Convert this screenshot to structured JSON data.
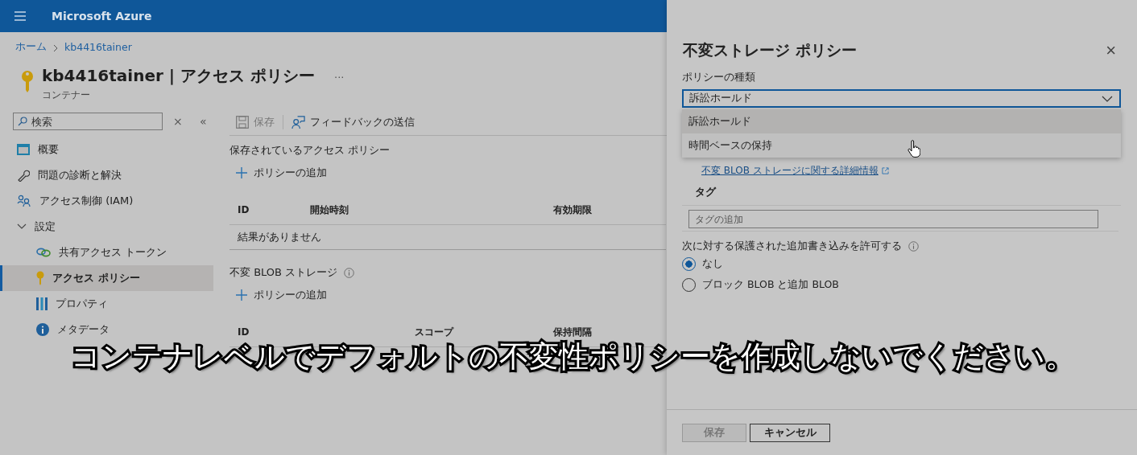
{
  "topbar": {
    "title": "Microsoft Azure"
  },
  "breadcrumb": [
    {
      "label": "ホーム"
    },
    {
      "label": "kb4416tainer"
    }
  ],
  "header": {
    "title": "kb4416tainer | アクセス ポリシー",
    "more": "...",
    "subtitle": "コンテナー"
  },
  "sidebar": {
    "search": {
      "placeholder": "検索"
    },
    "clear": "×",
    "collapse": "«",
    "items": [
      {
        "kind": "overview",
        "label": "概要",
        "selected": false
      },
      {
        "kind": "wrench",
        "label": "問題の診断と解決",
        "selected": false
      },
      {
        "kind": "people",
        "label": "アクセス制御 (IAM)",
        "selected": false
      },
      {
        "kind": "group",
        "label": "設定",
        "expanded": true,
        "selected": false,
        "children": [
          {
            "kind": "link",
            "label": "共有アクセス トークン",
            "selected": false
          },
          {
            "kind": "key",
            "label": "アクセス ポリシー",
            "selected": true
          },
          {
            "kind": "bars",
            "label": "プロパティ",
            "selected": false
          },
          {
            "kind": "info",
            "label": "メタデータ",
            "selected": false
          }
        ]
      }
    ]
  },
  "toolbar": [
    {
      "kind": "save",
      "label": "保存",
      "disabled": true
    },
    {
      "kind": "feedback",
      "label": "フィードバックの送信",
      "disabled": false
    }
  ],
  "sections": [
    {
      "title": "保存されているアクセス ポリシー",
      "info": false,
      "add": "ポリシーの追加",
      "columns": [
        "ID",
        "開始時刻",
        "有効期限"
      ],
      "rows": [
        "結果がありません"
      ]
    },
    {
      "title": "不変 BLOB ストレージ",
      "info": true,
      "add": "ポリシーの追加",
      "columns": [
        "ID",
        "スコープ",
        "保持間隔"
      ]
    }
  ],
  "panel": {
    "title": "不変ストレージ ポリシー",
    "close": "×",
    "policy_type": {
      "label": "ポリシーの種類",
      "value": "訴訟ホールド",
      "expanded": true,
      "options": [
        {
          "label": "訴訟ホールド",
          "selected": true
        },
        {
          "label": "時間ベースの保持",
          "selected": false
        }
      ]
    },
    "link": "不変 BLOB ストレージに関する詳細情報",
    "tags": {
      "heading": "タグ",
      "placeholder": "タグの追加"
    },
    "append": {
      "label": "次に対する保護された追加書き込みを許可する",
      "options": [
        {
          "label": "なし",
          "selected": true
        },
        {
          "label": "ブロック BLOB と追加 BLOB",
          "selected": false
        }
      ]
    },
    "buttons": [
      {
        "label": "保存",
        "disabled": true
      },
      {
        "label": "キャンセル",
        "disabled": false
      }
    ]
  },
  "caption": "コンテナレベルでデフォルトの不変性ポリシーを作成しないでください。"
}
